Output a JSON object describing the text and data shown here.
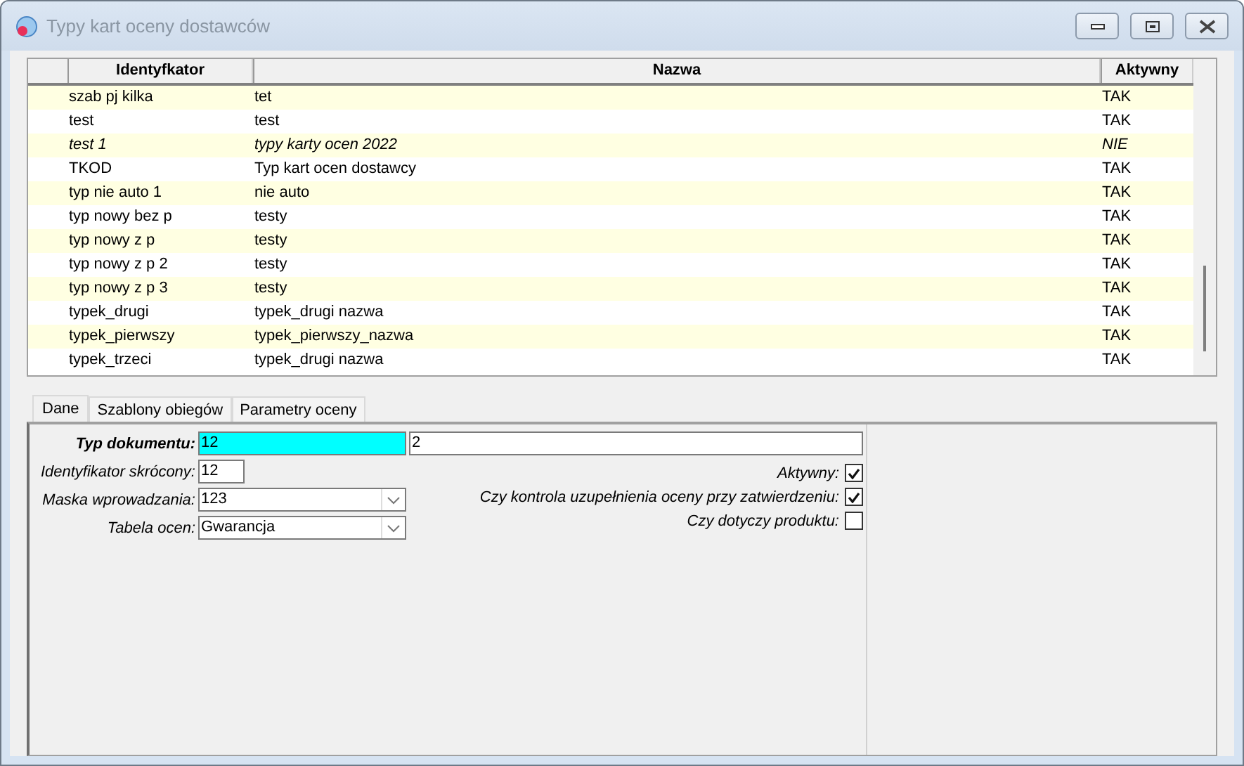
{
  "window": {
    "title": "Typy kart oceny dostawców"
  },
  "table": {
    "columns": [
      "Identyfkator",
      "Nazwa",
      "Aktywny"
    ],
    "rows": [
      {
        "cells": [
          "szab pj kilka",
          "tet",
          "TAK"
        ],
        "disabled": false
      },
      {
        "cells": [
          "test",
          "test",
          "TAK"
        ],
        "disabled": false
      },
      {
        "cells": [
          "test 1",
          "typy karty ocen 2022",
          "NIE"
        ],
        "disabled": true
      },
      {
        "cells": [
          "TKOD",
          "Typ kart ocen dostawcy",
          "TAK"
        ],
        "disabled": false
      },
      {
        "cells": [
          "typ nie auto 1",
          "nie auto",
          "TAK"
        ],
        "disabled": false
      },
      {
        "cells": [
          "typ nowy bez p",
          "testy",
          "TAK"
        ],
        "disabled": false
      },
      {
        "cells": [
          "typ nowy z p",
          "testy",
          "TAK"
        ],
        "disabled": false
      },
      {
        "cells": [
          "typ nowy z p 2",
          "testy",
          "TAK"
        ],
        "disabled": false
      },
      {
        "cells": [
          "typ nowy z p 3",
          "testy",
          "TAK"
        ],
        "disabled": false
      },
      {
        "cells": [
          "typek_drugi",
          "typek_drugi nazwa",
          "TAK"
        ],
        "disabled": false
      },
      {
        "cells": [
          "typek_pierwszy",
          "typek_pierwszy_nazwa",
          "TAK"
        ],
        "disabled": false
      },
      {
        "cells": [
          "typek_trzeci",
          "typek_drugi nazwa",
          "TAK"
        ],
        "disabled": false
      }
    ]
  },
  "tabs": [
    {
      "label": "Dane",
      "selected": true
    },
    {
      "label": "Szablony obiegów",
      "selected": false
    },
    {
      "label": "Parametry oceny",
      "selected": false
    }
  ],
  "form": {
    "typ_dokumentu": {
      "label": "Typ dokumentu:",
      "value": "12",
      "value_2": "2"
    },
    "identyfikator": {
      "label": "Identyfikator skrócony:",
      "value": "12"
    },
    "maska": {
      "label": "Maska wprowadzania:",
      "value": "123"
    },
    "tabela": {
      "label": "Tabela ocen:",
      "value": "Gwarancja"
    },
    "checks": [
      {
        "label": "Aktywny:",
        "checked": true
      },
      {
        "label": "Czy kontrola uzupełnienia oceny przy zatwierdzeniu:",
        "checked": true
      },
      {
        "label": "Czy dotyczy produktu:",
        "checked": false
      }
    ]
  }
}
